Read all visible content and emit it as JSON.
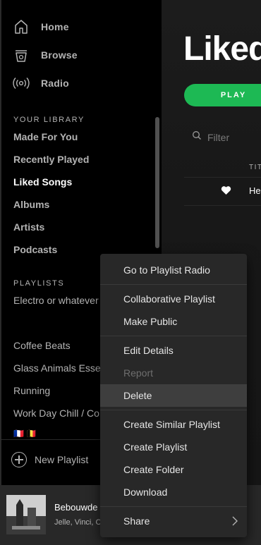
{
  "nav": [
    {
      "label": "Home",
      "icon": "home-icon"
    },
    {
      "label": "Browse",
      "icon": "browse-icon"
    },
    {
      "label": "Radio",
      "icon": "radio-icon"
    }
  ],
  "library": {
    "section_label": "YOUR LIBRARY",
    "items": [
      "Made For You",
      "Recently Played",
      "Liked Songs",
      "Albums",
      "Artists",
      "Podcasts"
    ],
    "active": "Liked Songs"
  },
  "playlists": {
    "section_label": "PLAYLISTS",
    "items": [
      "Electro or whatever",
      "Coffee Beats",
      "Glass Animals Essentials",
      "Running",
      "Work Day Chill / Co",
      "🇫🇷 🇧🇪"
    ]
  },
  "new_playlist_label": "New Playlist",
  "now_playing": {
    "title": "Bebouwde",
    "artist": "Jelle, Vinci, Co"
  },
  "main": {
    "title": "Liked Songs",
    "play_label": "PLAY",
    "filter_placeholder": "Filter",
    "title_column": "TITLE",
    "first_song": "He"
  },
  "context_menu": {
    "items": [
      {
        "label": "Go to Playlist Radio"
      },
      {
        "label": "Collaborative Playlist"
      },
      {
        "label": "Make Public"
      },
      {
        "label": "Edit Details"
      },
      {
        "label": "Report",
        "disabled": true
      },
      {
        "label": "Delete",
        "hovered": true
      },
      {
        "label": "Create Similar Playlist"
      },
      {
        "label": "Create Playlist"
      },
      {
        "label": "Create Folder"
      },
      {
        "label": "Download"
      },
      {
        "label": "Share",
        "has_submenu": true
      }
    ]
  },
  "colors": {
    "accent": "#1db954",
    "sidebar": "#000000",
    "menu": "#282828",
    "menu_hover": "#3e3e3e"
  }
}
